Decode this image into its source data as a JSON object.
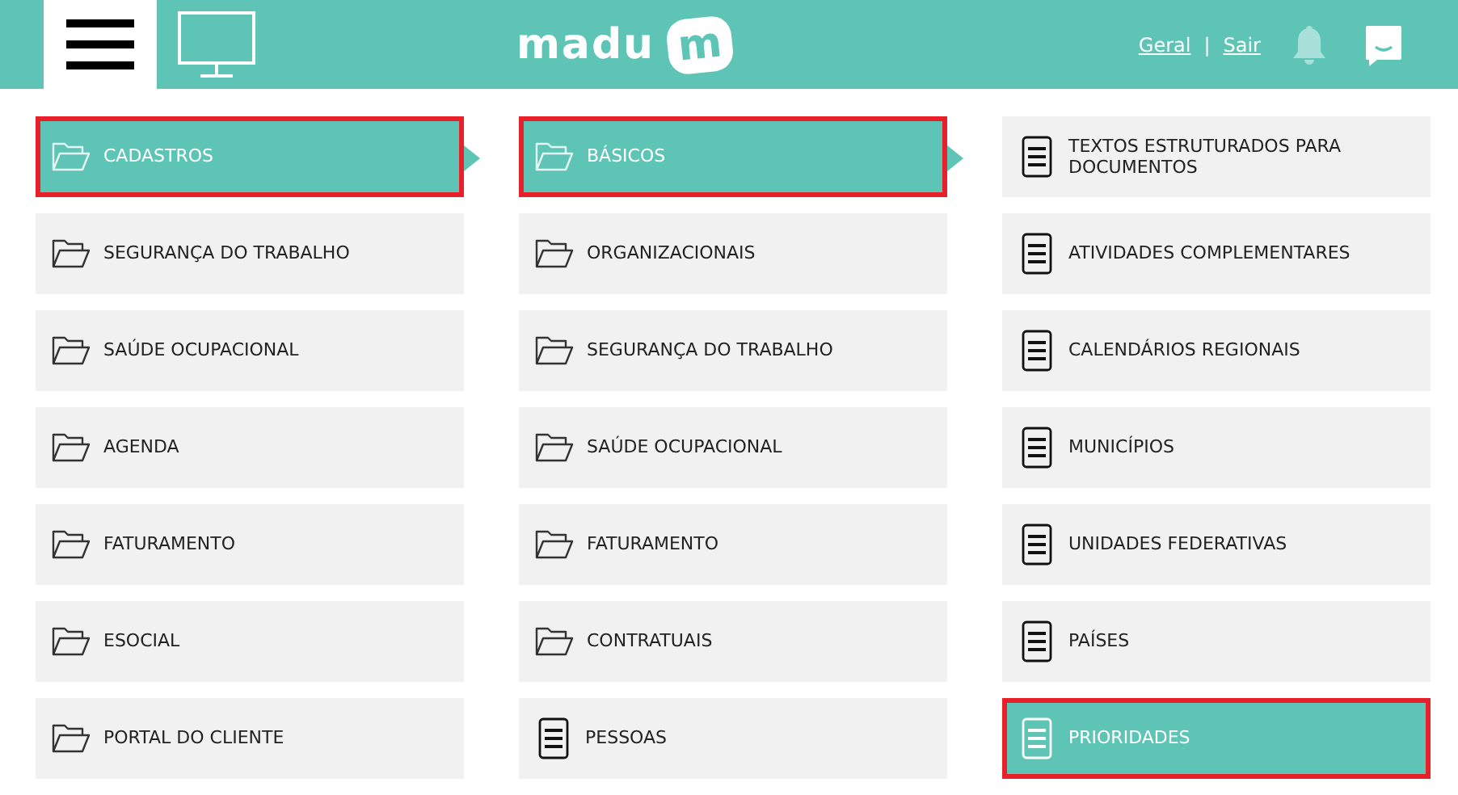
{
  "header": {
    "logo_text": "madu",
    "logo_mark": "m",
    "links": [
      "Geral",
      "Sair"
    ],
    "separator": "|"
  },
  "columns": [
    {
      "items": [
        {
          "label": "CADASTROS",
          "kind": "folder",
          "selected": true,
          "expanded": true
        },
        {
          "label": "SEGURANÇA DO TRABALHO",
          "kind": "folder",
          "selected": false,
          "expanded": false
        },
        {
          "label": "SAÚDE OCUPACIONAL",
          "kind": "folder",
          "selected": false,
          "expanded": false
        },
        {
          "label": "AGENDA",
          "kind": "folder",
          "selected": false,
          "expanded": false
        },
        {
          "label": "FATURAMENTO",
          "kind": "folder",
          "selected": false,
          "expanded": false
        },
        {
          "label": "ESOCIAL",
          "kind": "folder",
          "selected": false,
          "expanded": false
        },
        {
          "label": "PORTAL DO CLIENTE",
          "kind": "folder",
          "selected": false,
          "expanded": false
        }
      ]
    },
    {
      "items": [
        {
          "label": "BÁSICOS",
          "kind": "folder",
          "selected": true,
          "expanded": true
        },
        {
          "label": "ORGANIZACIONAIS",
          "kind": "folder",
          "selected": false,
          "expanded": false
        },
        {
          "label": "SEGURANÇA DO TRABALHO",
          "kind": "folder",
          "selected": false,
          "expanded": false
        },
        {
          "label": "SAÚDE OCUPACIONAL",
          "kind": "folder",
          "selected": false,
          "expanded": false
        },
        {
          "label": "FATURAMENTO",
          "kind": "folder",
          "selected": false,
          "expanded": false
        },
        {
          "label": "CONTRATUAIS",
          "kind": "folder",
          "selected": false,
          "expanded": false
        },
        {
          "label": "PESSOAS",
          "kind": "document",
          "selected": false,
          "expanded": false
        }
      ]
    },
    {
      "items": [
        {
          "label": "TEXTOS ESTRUTURADOS PARA DOCUMENTOS",
          "kind": "document",
          "selected": false,
          "expanded": false
        },
        {
          "label": "ATIVIDADES COMPLEMENTARES",
          "kind": "document",
          "selected": false,
          "expanded": false
        },
        {
          "label": "CALENDÁRIOS REGIONAIS",
          "kind": "document",
          "selected": false,
          "expanded": false
        },
        {
          "label": "MUNICÍPIOS",
          "kind": "document",
          "selected": false,
          "expanded": false
        },
        {
          "label": "UNIDADES FEDERATIVAS",
          "kind": "document",
          "selected": false,
          "expanded": false
        },
        {
          "label": "PAÍSES",
          "kind": "document",
          "selected": false,
          "expanded": false
        },
        {
          "label": "PRIORIDADES",
          "kind": "document",
          "selected": true,
          "expanded": false
        }
      ]
    }
  ]
}
